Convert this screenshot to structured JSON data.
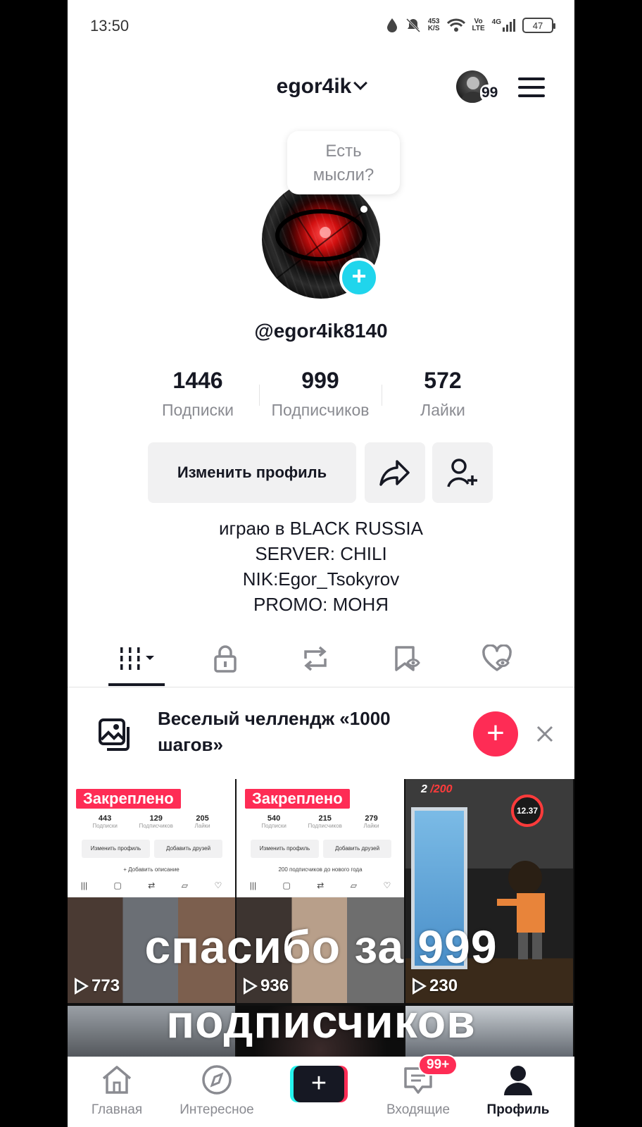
{
  "status_bar": {
    "time": "13:50",
    "net_speed_value": "453",
    "net_speed_unit": "K/S",
    "volte_top": "Vo",
    "volte_bottom": "LTE",
    "network": "4G",
    "battery": "47",
    "icons": [
      "water-drop-icon",
      "bell-off-icon",
      "wifi-icon",
      "signal-icon",
      "battery-icon"
    ]
  },
  "header": {
    "username": "egor4ik",
    "avatar_badge": "99"
  },
  "profile": {
    "bubble_line1": "Есть",
    "bubble_line2": "мысли?",
    "handle": "@egor4ik8140",
    "stats": [
      {
        "value": "1446",
        "label": "Подписки"
      },
      {
        "value": "999",
        "label": "Подписчиков"
      },
      {
        "value": "572",
        "label": "Лайки"
      }
    ],
    "edit_button": "Изменить профиль",
    "bio": [
      "играю в BLACK RUSSIA",
      "SERVER: CHILI",
      "NIK:Egor_Tsokyrov",
      "PROMO: МОНЯ"
    ]
  },
  "tabs": [
    "videos-grid-icon",
    "lock-icon",
    "repost-icon",
    "favorites-icon",
    "liked-icon"
  ],
  "banner": {
    "title_line1": "Веселый челлендж «1000",
    "title_line2": "шагов»"
  },
  "grid": {
    "pinned_label": "Закреплено",
    "videos": [
      {
        "views": "773",
        "pinned": true,
        "mini_stats": [
          {
            "value": "443",
            "label": "Подписки"
          },
          {
            "value": "129",
            "label": "Подписчиков"
          },
          {
            "value": "205",
            "label": "Лайки"
          }
        ],
        "mini_btn1": "Изменить профиль",
        "mini_btn2": "Добавить друзей",
        "mini_line": "+ Добавить описание"
      },
      {
        "views": "936",
        "pinned": true,
        "mini_stats": [
          {
            "value": "540",
            "label": "Подписки"
          },
          {
            "value": "215",
            "label": "Подписчиков"
          },
          {
            "value": "279",
            "label": "Лайки"
          }
        ],
        "mini_btn1": "Изменить профиль",
        "mini_btn2": "Добавить друзей",
        "mini_line": "200 подписчиков до нового года"
      },
      {
        "views": "230",
        "pinned": false,
        "game_counter_left": "2",
        "game_counter_right": "/200",
        "game_timer": "12.37"
      }
    ],
    "overlay_line1": "спасибо за 999",
    "overlay_line2": "подписчиков"
  },
  "bottom_nav": {
    "home": "Главная",
    "discover": "Интересное",
    "inbox": "Входящие",
    "inbox_badge": "99+",
    "profile": "Профиль"
  },
  "colors": {
    "accent_red": "#fe2c55",
    "accent_cyan": "#25f4ee",
    "plus_blue": "#20d5ec",
    "text_primary": "#161823",
    "text_secondary": "#8a8b91"
  }
}
